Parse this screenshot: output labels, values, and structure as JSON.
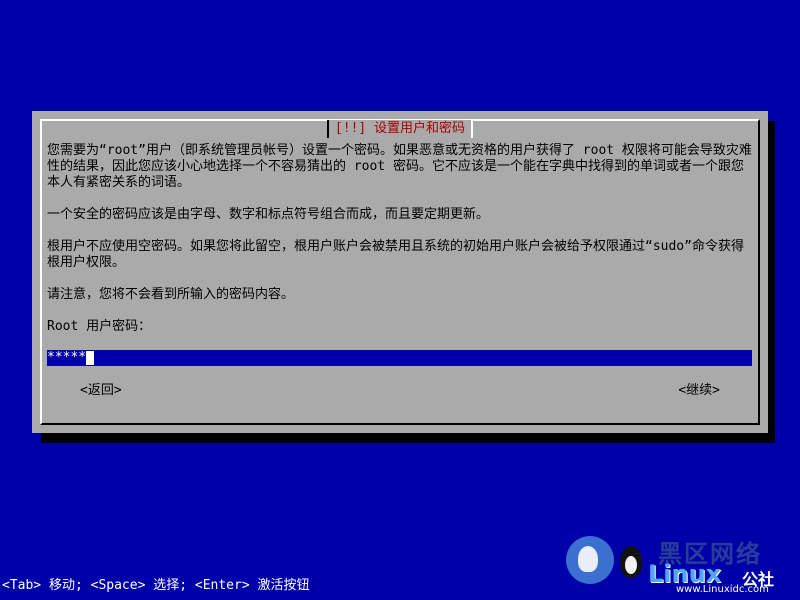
{
  "dialog": {
    "title": "[!!] 设置用户和密码",
    "paragraphs": [
      "您需要为“root”用户（即系统管理员帐号）设置一个密码。如果恶意或无资格的用户获得了 root 权限将可能会导致灾难性的结果，因此您应该小心地选择一个不容易猜出的 root 密码。它不应该是一个能在字典中找得到的单词或者一个跟您本人有紧密关系的词语。",
      "一个安全的密码应该是由字母、数字和标点符号组合而成，而且要定期更新。",
      "根用户不应使用空密码。如果您将此留空，根用户账户会被禁用且系统的初始用户账户会被给予权限通过“sudo”命令获得根用户权限。",
      "请注意，您将不会看到所输入的密码内容。",
      "Root 用户密码："
    ],
    "password_value": "*****",
    "back_label": "<返回>",
    "continue_label": "<继续>"
  },
  "footer": {
    "hint": "<Tab> 移动; <Space> 选择; <Enter> 激活按钮"
  },
  "watermark": {
    "cn_title": "黑区网络",
    "brand": "Linux",
    "brand_cn": "公社",
    "url": "www.Linuxidc.com"
  }
}
